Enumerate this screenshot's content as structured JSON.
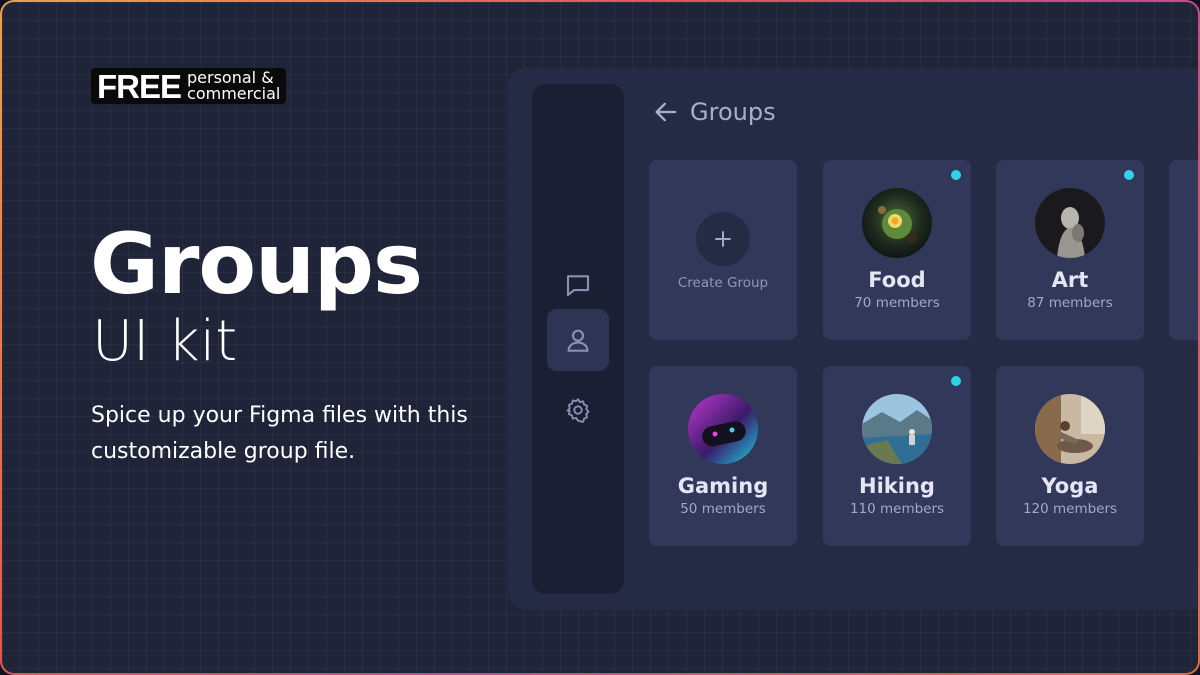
{
  "badge": {
    "free": "FREE",
    "line1": "personal &",
    "line2": "commercial"
  },
  "hero": {
    "title": "Groups",
    "subtitle": "UI kit",
    "description": "Spice up your Figma files with this customizable group file."
  },
  "app": {
    "header": {
      "title": "Groups",
      "back_icon": "arrow-left-icon"
    },
    "rail": [
      {
        "icon": "chat-icon",
        "active": false
      },
      {
        "icon": "user-icon",
        "active": true
      },
      {
        "icon": "settings-icon",
        "active": false
      }
    ],
    "create_card": {
      "label": "Create Group",
      "icon": "plus-icon"
    },
    "groups": [
      {
        "name": "Food",
        "members": "70 members",
        "online": true
      },
      {
        "name": "Art",
        "members": "87 members",
        "online": true
      },
      {
        "name": "Gaming",
        "members": "50 members",
        "online": false
      },
      {
        "name": "Hiking",
        "members": "110 members",
        "online": true
      },
      {
        "name": "Yoga",
        "members": "120 members",
        "online": false
      }
    ]
  },
  "colors": {
    "background": "#1f2439",
    "panel": "#262b45",
    "card": "#323859",
    "online_dot": "#2fd3e6"
  }
}
